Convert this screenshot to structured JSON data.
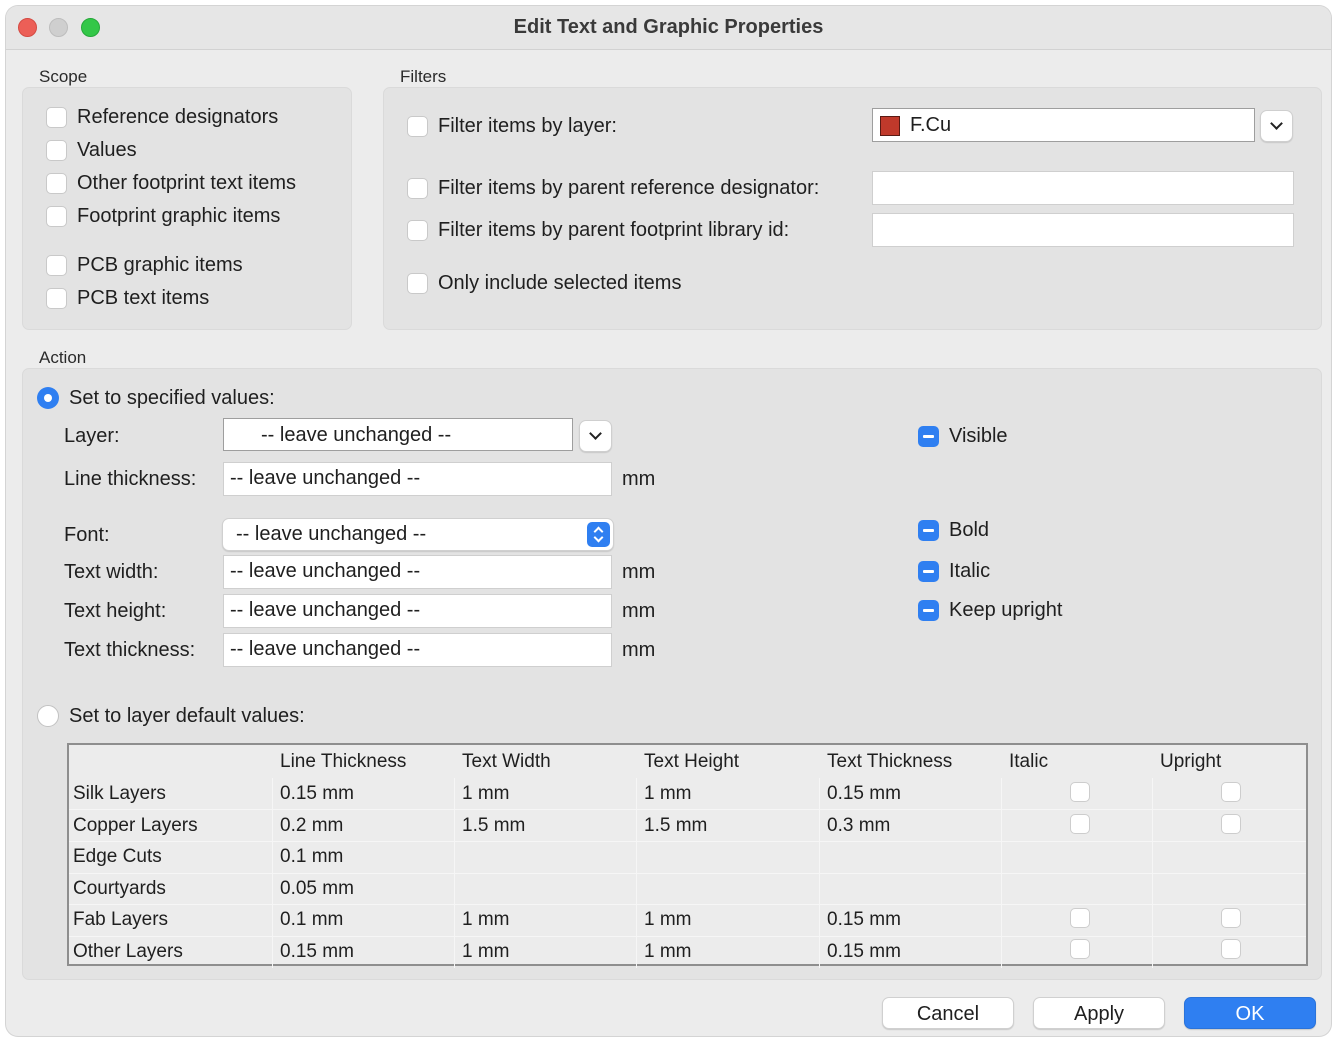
{
  "window": {
    "title": "Edit Text and Graphic Properties"
  },
  "scope": {
    "label": "Scope",
    "items": [
      "Reference designators",
      "Values",
      "Other footprint text items",
      "Footprint graphic items",
      "PCB graphic items",
      "PCB text items"
    ]
  },
  "filters": {
    "label": "Filters",
    "layer_label": "Filter items by layer:",
    "layer_value": "F.Cu",
    "layer_color": "#c0392b",
    "refdes_label": "Filter items by parent reference designator:",
    "refdes_value": "",
    "libid_label": "Filter items by parent footprint library id:",
    "libid_value": "",
    "selected_label": "Only include selected items"
  },
  "action": {
    "label": "Action",
    "specified_label": "Set to specified values:",
    "layer_label": "Layer:",
    "layer_value": "-- leave unchanged --",
    "line_thickness_label": "Line thickness:",
    "line_thickness_value": "-- leave unchanged --",
    "font_label": "Font:",
    "font_value": "-- leave unchanged --",
    "text_width_label": "Text width:",
    "text_width_value": "-- leave unchanged --",
    "text_height_label": "Text height:",
    "text_height_value": "-- leave unchanged --",
    "text_thickness_label": "Text thickness:",
    "text_thickness_value": "-- leave unchanged --",
    "unit": "mm",
    "visible_label": "Visible",
    "bold_label": "Bold",
    "italic_label": "Italic",
    "keep_upright_label": "Keep upright",
    "defaults_label": "Set to layer default values:"
  },
  "table": {
    "headers": [
      "",
      "Line Thickness",
      "Text Width",
      "Text Height",
      "Text Thickness",
      "Italic",
      "Upright"
    ],
    "rows": [
      {
        "name": "Silk Layers",
        "line": "0.15 mm",
        "width": "1 mm",
        "height": "1 mm",
        "thickness": "0.15 mm",
        "checks": true
      },
      {
        "name": "Copper Layers",
        "line": "0.2 mm",
        "width": "1.5 mm",
        "height": "1.5 mm",
        "thickness": "0.3 mm",
        "checks": true
      },
      {
        "name": "Edge Cuts",
        "line": "0.1 mm",
        "width": "",
        "height": "",
        "thickness": "",
        "checks": false
      },
      {
        "name": "Courtyards",
        "line": "0.05 mm",
        "width": "",
        "height": "",
        "thickness": "",
        "checks": false
      },
      {
        "name": "Fab Layers",
        "line": "0.1 mm",
        "width": "1 mm",
        "height": "1 mm",
        "thickness": "0.15 mm",
        "checks": true
      },
      {
        "name": "Other Layers",
        "line": "0.15 mm",
        "width": "1 mm",
        "height": "1 mm",
        "thickness": "0.15 mm",
        "checks": true
      }
    ]
  },
  "buttons": {
    "cancel": "Cancel",
    "apply": "Apply",
    "ok": "OK"
  }
}
